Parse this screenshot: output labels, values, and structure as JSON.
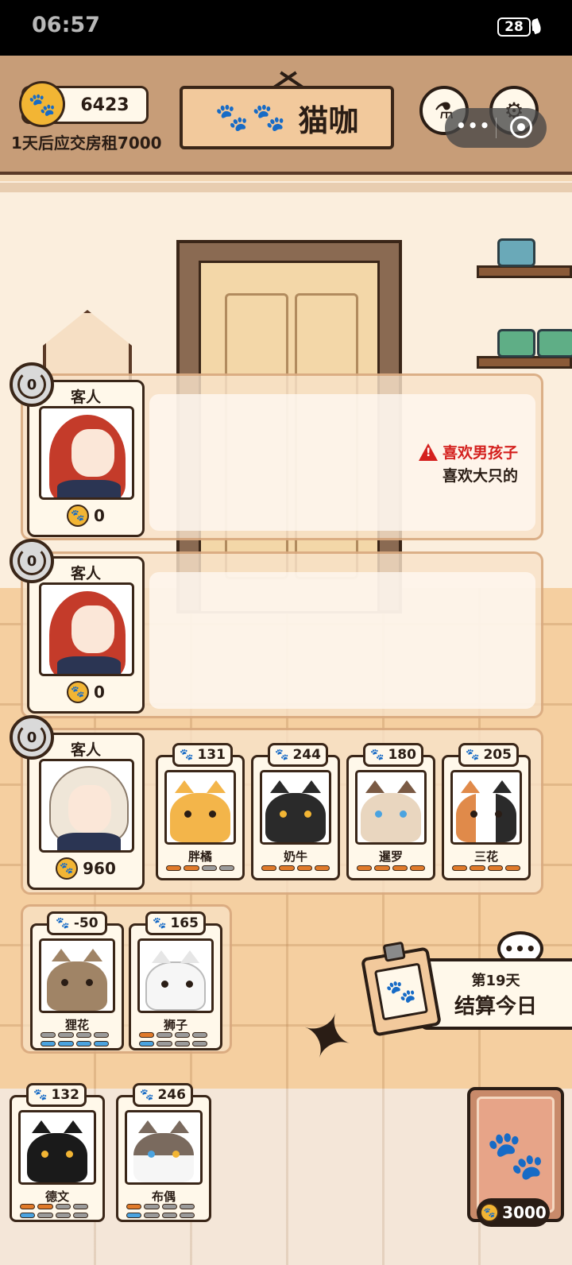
{
  "status_bar": {
    "time": "06:57",
    "battery": "28"
  },
  "header": {
    "coins": "6423",
    "rent_notice": "1天后应交房租7000",
    "title": "猫咖",
    "title_paws": "🐾🐾",
    "capsule_dots": "•••"
  },
  "customers": [
    {
      "label": "客人",
      "refresh": "0",
      "coins": "0",
      "requirements": [
        {
          "text": "喜欢男孩子",
          "warning": true
        },
        {
          "text": "喜欢大只的",
          "warning": false
        }
      ]
    },
    {
      "label": "客人",
      "refresh": "0",
      "coins": "0",
      "requirements": []
    },
    {
      "label": "客人",
      "refresh": "0",
      "coins": "960",
      "requirements": []
    }
  ],
  "seated_cats": [
    {
      "name": "胖橘",
      "value": "131",
      "bars": [
        "o",
        "o",
        "g",
        "g"
      ]
    },
    {
      "name": "奶牛",
      "value": "244",
      "bars": [
        "o",
        "o",
        "o",
        "o"
      ]
    },
    {
      "name": "暹罗",
      "value": "180",
      "bars": [
        "o",
        "o",
        "o",
        "o"
      ]
    },
    {
      "name": "三花",
      "value": "205",
      "bars": [
        "o",
        "o",
        "o",
        "o"
      ]
    }
  ],
  "bench_cats": [
    {
      "name": "狸花",
      "value": "-50",
      "bars_top": [
        "g",
        "g",
        "g",
        "g"
      ],
      "bars_bottom": [
        "b",
        "b",
        "b",
        "b"
      ]
    },
    {
      "name": "狮子",
      "value": "165",
      "bars_top": [
        "o",
        "g",
        "g",
        "g"
      ],
      "bars_bottom": [
        "b",
        "g",
        "g",
        "g"
      ]
    }
  ],
  "hand_cats": [
    {
      "name": "德文",
      "value": "132",
      "bars_top": [
        "o",
        "o",
        "g",
        "g"
      ],
      "bars_bottom": [
        "b",
        "g",
        "g",
        "g"
      ]
    },
    {
      "name": "布偶",
      "value": "246",
      "bars_top": [
        "o",
        "g",
        "g",
        "g"
      ],
      "bars_bottom": [
        "b",
        "g",
        "g",
        "g"
      ]
    }
  ],
  "settle": {
    "day": "第19天",
    "label": "结算今日",
    "bubble": "•••"
  },
  "deck": {
    "price": "3000"
  },
  "icons": {
    "coin": "paw-coin-icon",
    "paw": "🐾"
  },
  "colors": {
    "warning": "#d4201e",
    "coin": "#f2b534",
    "bar_orange": "#e07a2a",
    "bar_blue": "#4aa3e0"
  }
}
